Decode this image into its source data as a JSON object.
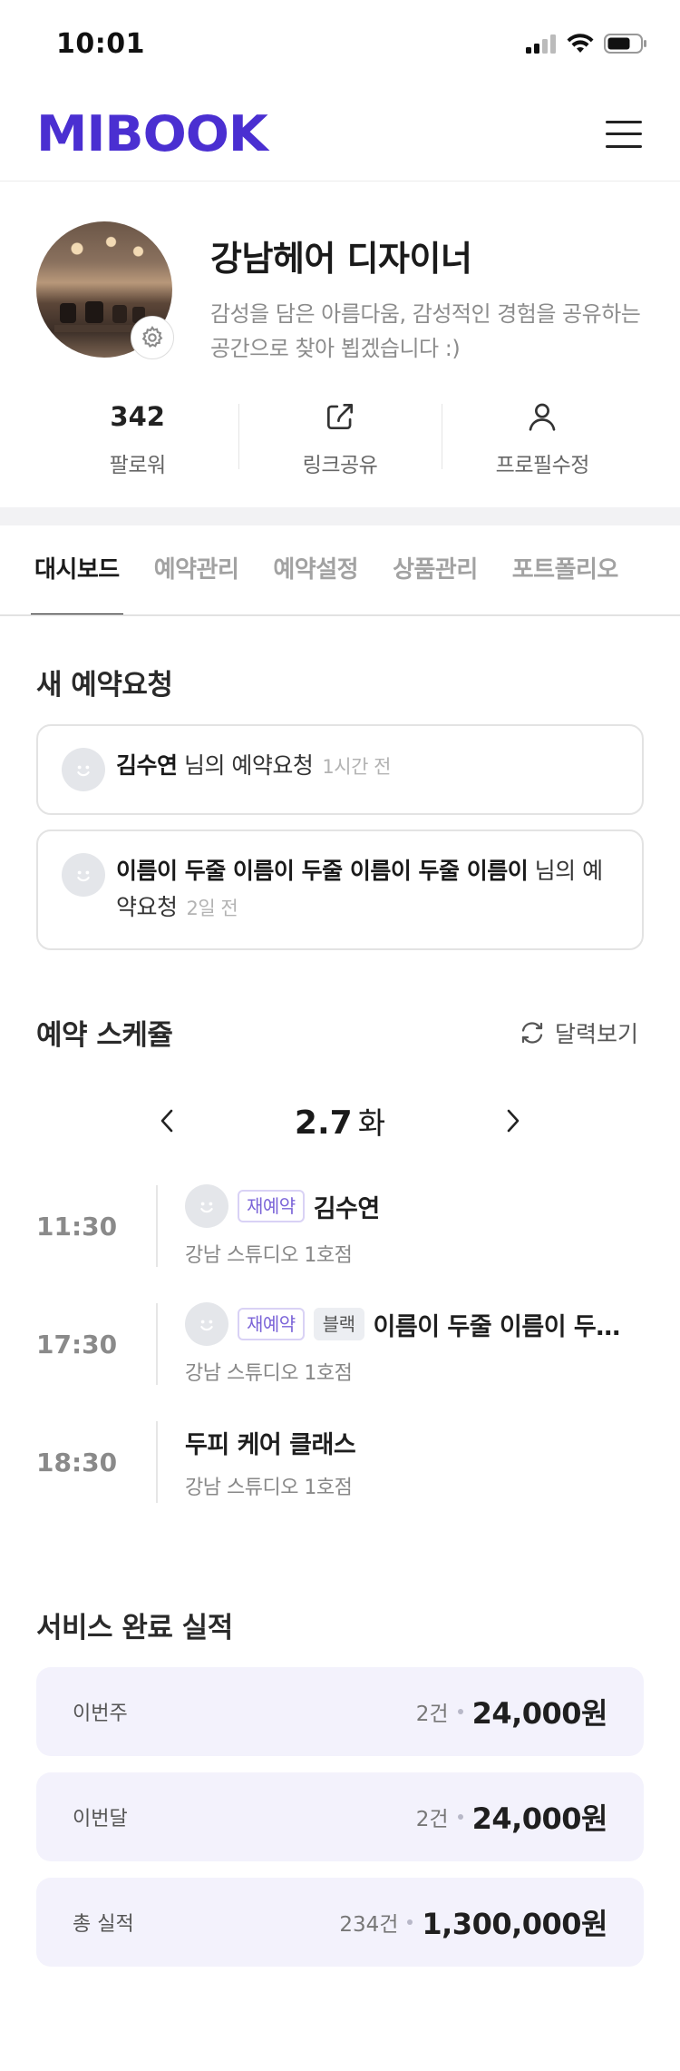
{
  "status_bar": {
    "time": "10:01"
  },
  "header": {
    "logo": "MIBOOK"
  },
  "profile": {
    "name": "강남헤어 디자이너",
    "description": "감성을 담은 아름다움, 감성적인 경험을 공유하는 공간으로 찾아 뵙겠습니다 :)",
    "followers_count": "342",
    "followers_label": "팔로워",
    "share_label": "링크공유",
    "edit_label": "프로필수정"
  },
  "tabs": [
    {
      "label": "대시보드",
      "active": true
    },
    {
      "label": "예약관리",
      "active": false
    },
    {
      "label": "예약설정",
      "active": false
    },
    {
      "label": "상품관리",
      "active": false
    },
    {
      "label": "포트폴리오",
      "active": false
    }
  ],
  "new_requests": {
    "title": "새 예약요청",
    "items": [
      {
        "name": "김수연",
        "suffix": " 님의 예약요청",
        "time": "1시간 전"
      },
      {
        "name": "이름이 두줄 이름이 두줄 이름이 두줄 이름이",
        "suffix": " 님의 예약요청",
        "time": "2일 전"
      }
    ]
  },
  "schedule": {
    "title": "예약 스케쥴",
    "calendar_label": "달력보기",
    "date": "2.7",
    "day_of_week": "화",
    "items": [
      {
        "time": "11:30",
        "tags": [
          "재예약"
        ],
        "name": "김수연",
        "location": "강남 스튜디오 1호점",
        "has_avatar": true
      },
      {
        "time": "17:30",
        "tags": [
          "재예약",
          "블랙"
        ],
        "name": "이름이 두줄 이름이 두줄...",
        "location": "강남 스튜디오 1호점",
        "has_avatar": true
      },
      {
        "time": "18:30",
        "tags": [],
        "name": "두피 케어 클래스",
        "location": "강남 스튜디오 1호점",
        "has_avatar": false
      }
    ]
  },
  "performance": {
    "title": "서비스 완료 실적",
    "items": [
      {
        "label": "이번주",
        "count": "2건",
        "amount": "24,000원"
      },
      {
        "label": "이번달",
        "count": "2건",
        "amount": "24,000원"
      },
      {
        "label": "총 실적",
        "count": "234건",
        "amount": "1,300,000원"
      }
    ]
  },
  "colors": {
    "brand": "#4a2fd1",
    "tag_re": "#7b64d8",
    "perf_bg": "#f3f2fc"
  },
  "icons": {
    "status": [
      "signal-icon",
      "wifi-icon",
      "battery-icon"
    ],
    "menu": "hamburger-menu-icon",
    "settings": "gear-icon",
    "share": "share-icon",
    "edit": "person-icon",
    "calendar": "refresh-icon",
    "prev": "chevron-left-icon",
    "next": "chevron-right-icon"
  }
}
